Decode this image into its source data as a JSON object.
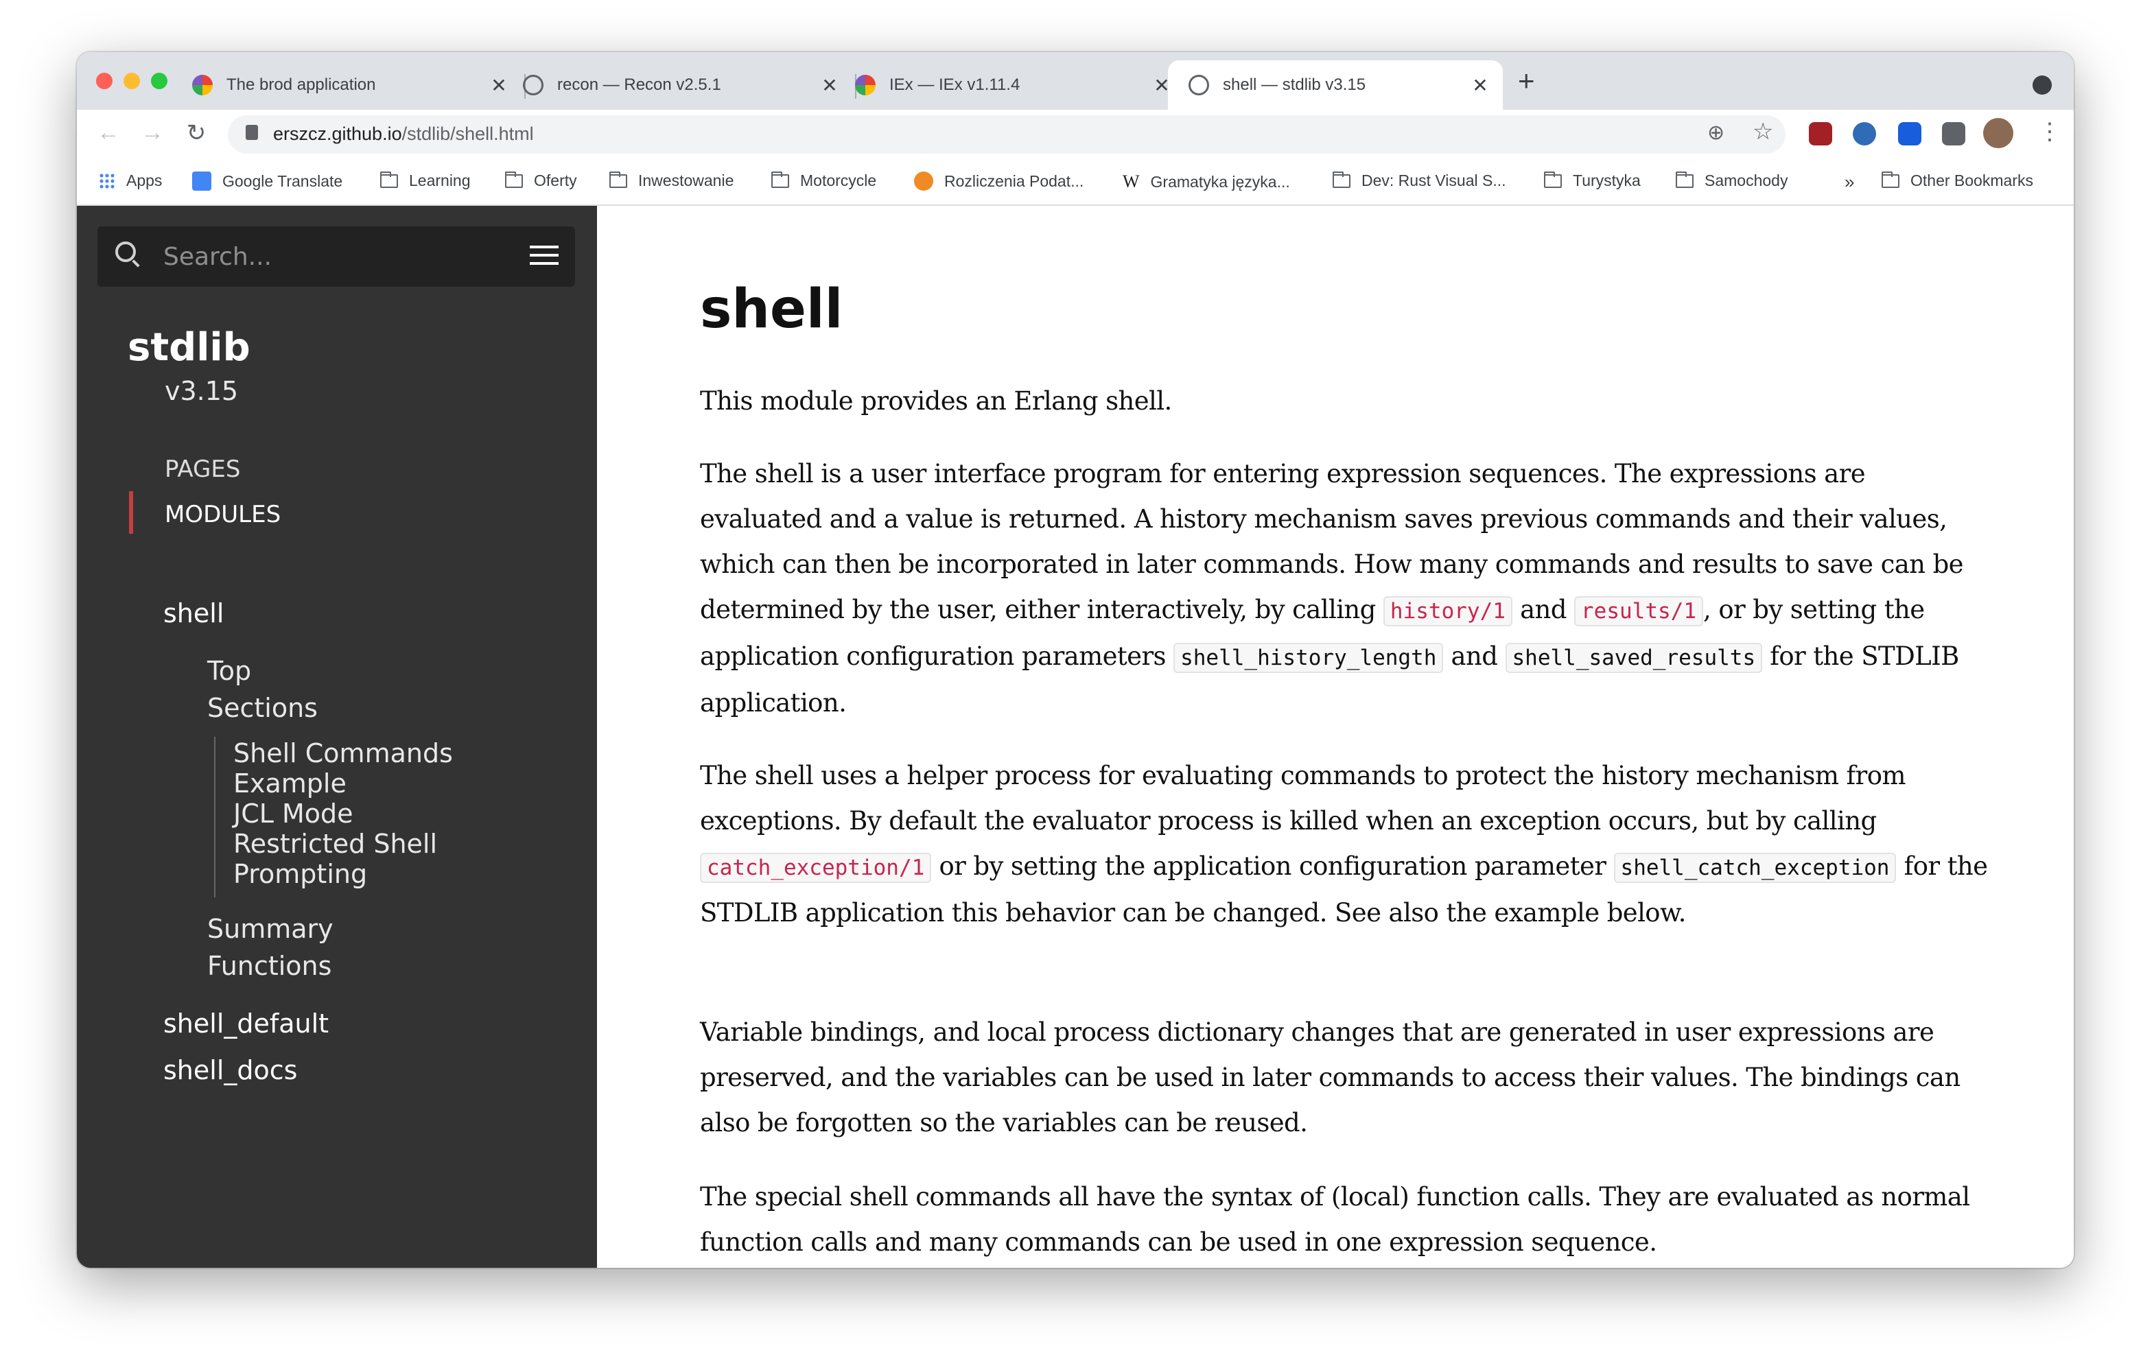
{
  "browser": {
    "tabs": [
      {
        "title": "The brod application",
        "favicon": "hex-logo-icon"
      },
      {
        "title": "recon — Recon v2.5.1",
        "favicon": "globe-icon"
      },
      {
        "title": "IEx — IEx v1.11.4",
        "favicon": "hex-logo-icon"
      },
      {
        "title": "shell — stdlib v3.15",
        "favicon": "globe-icon",
        "active": true
      }
    ],
    "new_tab_label": "+",
    "url_host": "erszcz.github.io",
    "url_path": "/stdlib/shell.html",
    "bookmarks": [
      {
        "label": "Apps",
        "icon": "apps-grid-icon"
      },
      {
        "label": "Google Translate",
        "icon": "translate-icon"
      },
      {
        "label": "Learning",
        "icon": "folder-icon"
      },
      {
        "label": "Oferty",
        "icon": "folder-icon"
      },
      {
        "label": "Inwestowanie",
        "icon": "folder-icon"
      },
      {
        "label": "Motorcycle",
        "icon": "folder-icon"
      },
      {
        "label": "Rozliczenia Podat...",
        "icon": "check-logo-icon"
      },
      {
        "label": "Gramatyka języka...",
        "icon": "wikipedia-icon"
      },
      {
        "label": "Dev: Rust Visual S...",
        "icon": "folder-icon"
      },
      {
        "label": "Turystyka",
        "icon": "folder-icon"
      },
      {
        "label": "Samochody",
        "icon": "folder-icon"
      }
    ],
    "more_bookmarks": "»",
    "other_bookmarks": "Other Bookmarks"
  },
  "sidebar": {
    "search_placeholder": "Search...",
    "project": "stdlib",
    "version": "v3.15",
    "nav": {
      "pages": "PAGES",
      "modules": "MODULES"
    },
    "current_module": "shell",
    "toc": {
      "top": "Top",
      "sections": "Sections",
      "section_items": [
        "Shell Commands",
        "Example",
        "JCL Mode",
        "Restricted Shell",
        "Prompting"
      ],
      "summary": "Summary",
      "functions": "Functions"
    },
    "other_modules": [
      "shell_default",
      "shell_docs"
    ]
  },
  "content": {
    "title": "shell",
    "p1": "This module provides an Erlang shell.",
    "p2": {
      "t1": "The shell is a user interface program for entering expression sequences. The expressions are evaluated and a value is returned. A history mechanism saves previous commands and their values, which can then be incorporated in later commands. How many commands and results to save can be determined by the user, either interactively, by calling ",
      "c1": "history/1",
      "t2": " and ",
      "c2": "results/1",
      "t3": ", or by setting the application configuration parameters ",
      "c3": "shell_history_length",
      "t4": " and ",
      "c4": "shell_saved_results",
      "t5": " for the STDLIB application."
    },
    "p3": {
      "t1": "The shell uses a helper process for evaluating commands to protect the history mechanism from exceptions. By default the evaluator process is killed when an exception occurs, but by calling ",
      "c1": "catch_exception/1",
      "t2": " or by setting the application configuration parameter ",
      "c2": "shell_catch_exception",
      "t3": " for the STDLIB application this behavior can be changed. See also the example below."
    },
    "p4": "Variable bindings, and local process dictionary changes that are generated in user expressions are preserved, and the variables can be used in later commands to access their values. The bindings can also be forgotten so the variables can be reused.",
    "p5": "The special shell commands all have the syntax of (local) function calls. They are evaluated as normal function calls and many commands can be used in one expression sequence."
  },
  "colors": {
    "sidebar_bg": "#333333",
    "accent": "#c73e3e",
    "code_link": "#c7254e"
  }
}
